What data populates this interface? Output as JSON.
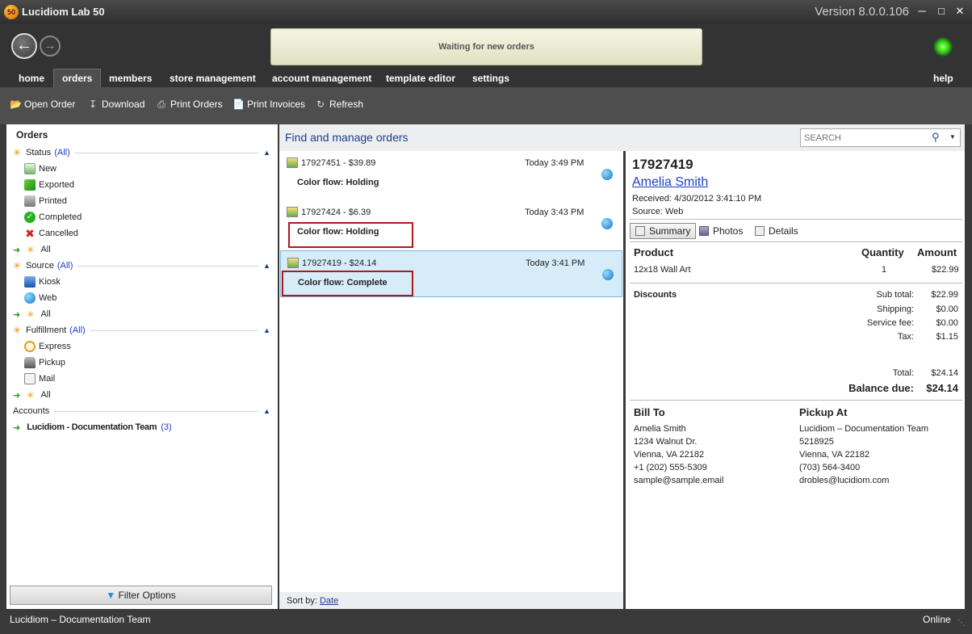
{
  "app": {
    "logo_text": "50",
    "title": "Lucidiom Lab 50",
    "version": "Version 8.0.0.106",
    "status_message": "Waiting for new orders"
  },
  "tabs": [
    {
      "label": "home"
    },
    {
      "label": "orders"
    },
    {
      "label": "members"
    },
    {
      "label": "store management"
    },
    {
      "label": "account management"
    },
    {
      "label": "template editor"
    },
    {
      "label": "settings"
    },
    {
      "label": "help"
    }
  ],
  "toolbar": {
    "open_order": "Open Order",
    "download": "Download",
    "print_orders": "Print Orders",
    "print_invoices": "Print Invoices",
    "refresh": "Refresh"
  },
  "left": {
    "header": "Orders",
    "status": {
      "label": "Status",
      "all": "(All)",
      "items": [
        "New",
        "Exported",
        "Printed",
        "Completed",
        "Cancelled",
        "All"
      ]
    },
    "source": {
      "label": "Source",
      "all": "(All)",
      "items": [
        "Kiosk",
        "Web",
        "All"
      ]
    },
    "fulfillment": {
      "label": "Fulfillment",
      "all": "(All)",
      "items": [
        "Express",
        "Pickup",
        "Mail",
        "All"
      ]
    },
    "accounts": {
      "label": "Accounts",
      "account_name": "Lucidiom - Documentation Team",
      "count": "(3)"
    },
    "filter_options": "Filter Options"
  },
  "middle": {
    "title": "Find and manage orders",
    "search_placeholder": "SEARCH",
    "orders": [
      {
        "id": "17927451 - $39.89",
        "time": "Today 3:49 PM",
        "flow": "Color flow: Holding"
      },
      {
        "id": "17927424 - $6.39",
        "time": "Today 3:43 PM",
        "flow": "Color flow: Holding"
      },
      {
        "id": "17927419 - $24.14",
        "time": "Today 3:41 PM",
        "flow": "Color flow: Complete"
      }
    ],
    "sort_by_label": "Sort by:",
    "sort_by_value": "Date"
  },
  "detail": {
    "order_number": "17927419",
    "customer_name": "Amelia Smith",
    "received": "Received: 4/30/2012 3:41:10 PM",
    "source": "Source: Web",
    "tabs": [
      "Summary",
      "Photos",
      "Details"
    ],
    "columns": {
      "product": "Product",
      "quantity": "Quantity",
      "amount": "Amount"
    },
    "line_item": {
      "product": "12x18 Wall Art",
      "quantity": "1",
      "amount": "$22.99"
    },
    "discounts_label": "Discounts",
    "totals": {
      "subtotal_label": "Sub total:",
      "subtotal": "$22.99",
      "shipping_label": "Shipping:",
      "shipping": "$0.00",
      "service_label": "Service fee:",
      "service": "$0.00",
      "tax_label": "Tax:",
      "tax": "$1.15",
      "total_label": "Total:",
      "total": "$24.14",
      "balance_label": "Balance due:",
      "balance": "$24.14"
    },
    "bill_to": {
      "heading": "Bill To",
      "lines": [
        "Amelia Smith",
        "1234 Walnut Dr.",
        "Vienna, VA 22182",
        "+1 (202) 555-5309",
        "sample@sample.email"
      ]
    },
    "pickup_at": {
      "heading": "Pickup At",
      "lines": [
        "Lucidiom – Documentation Team",
        "5218925",
        "Vienna, VA 22182",
        "(703) 564-3400",
        "drobles@lucidiom.com"
      ]
    }
  },
  "statusbar": {
    "account": "Lucidiom – Documentation Team",
    "connection": "Online"
  }
}
